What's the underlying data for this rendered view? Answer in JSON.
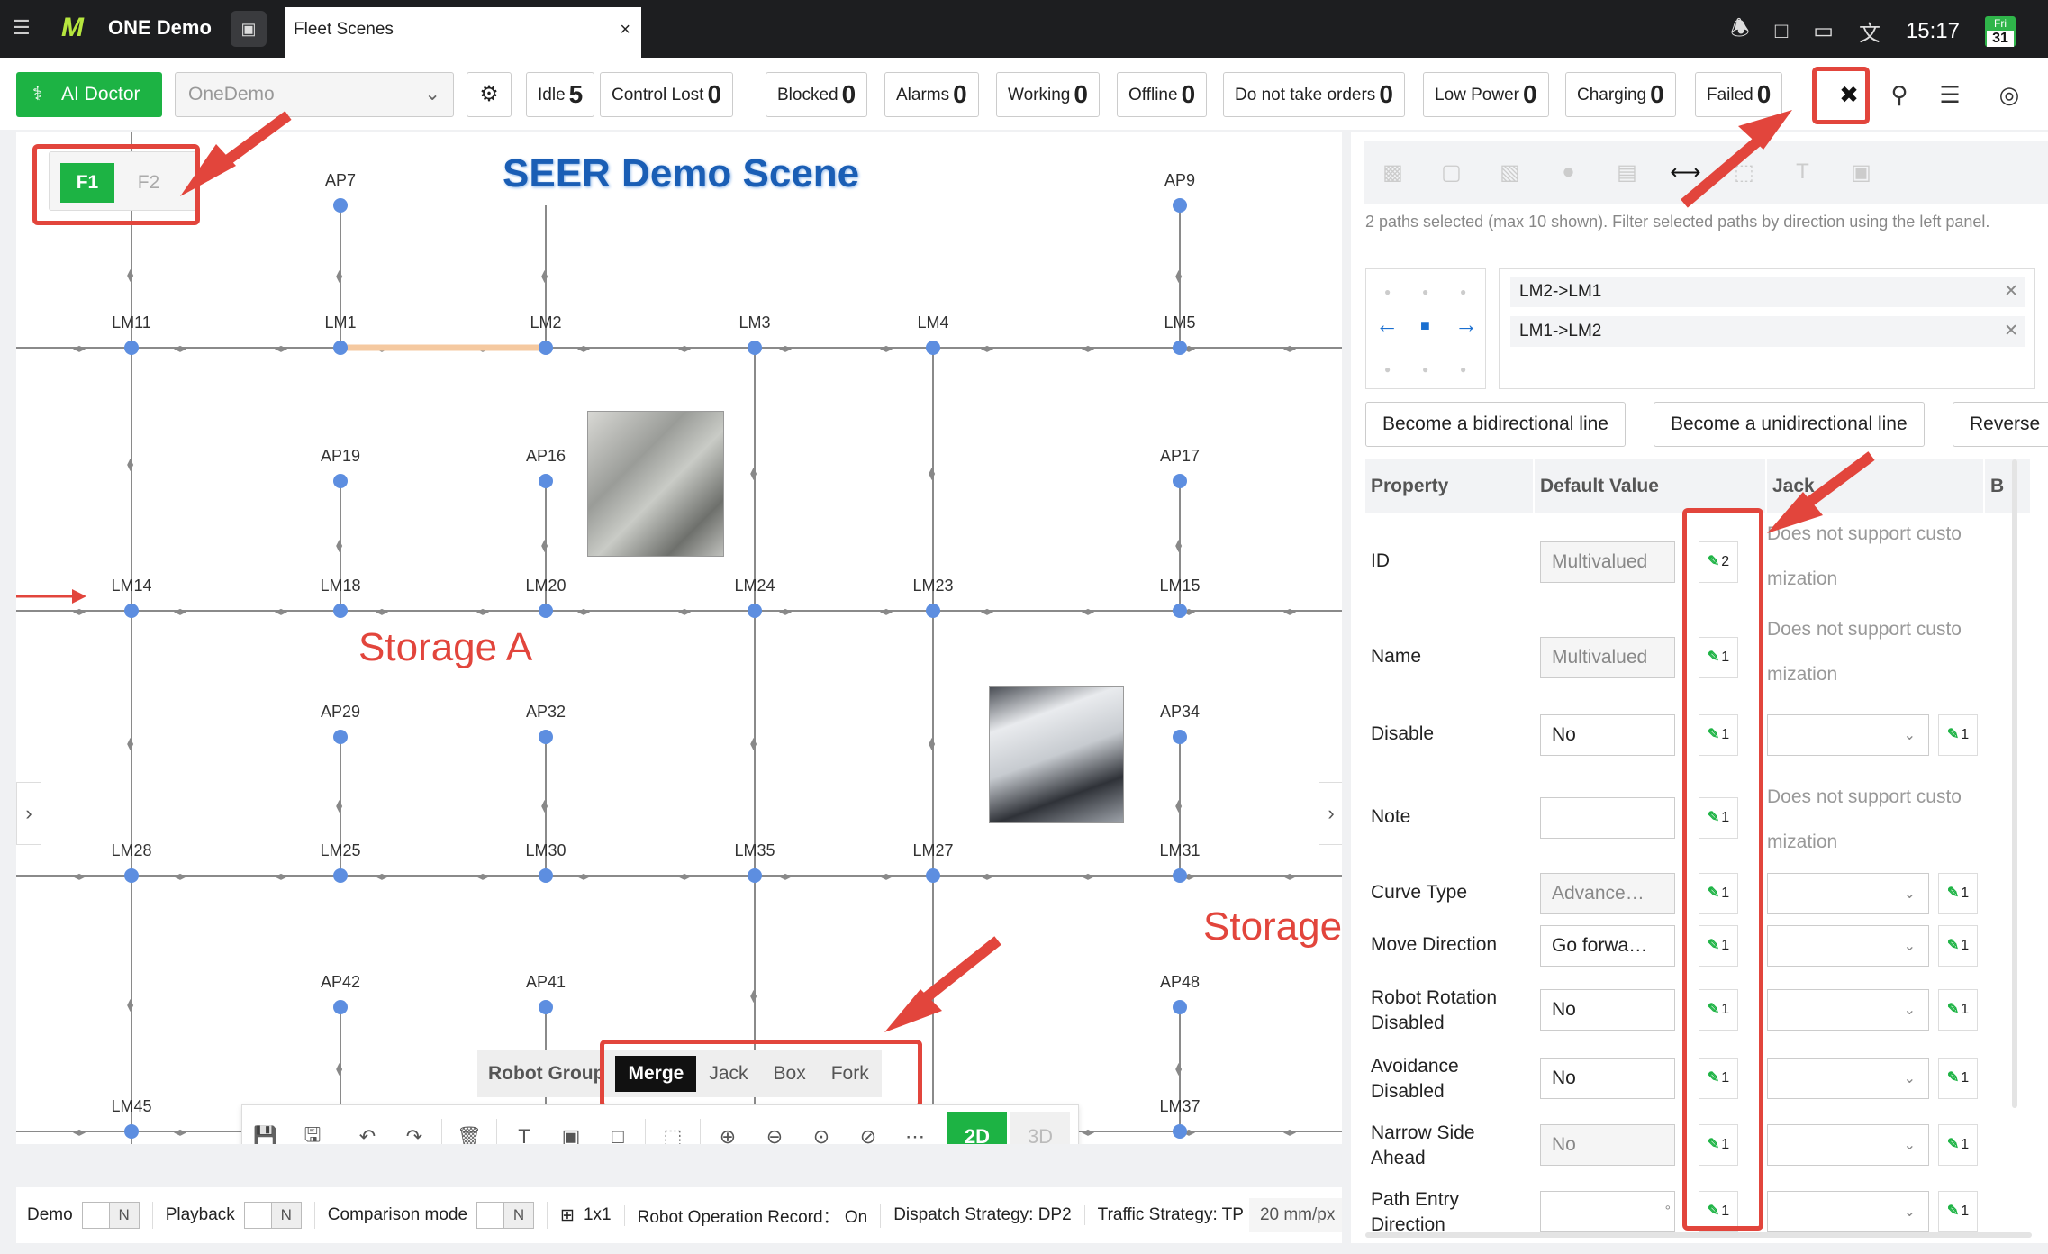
{
  "topbar": {
    "menu_icon": "menu-icon",
    "logo": "M",
    "app_name": "ONE Demo",
    "chip_icon": "ai-chip-icon",
    "tab_label": "Fleet Scenes",
    "tab_close": "×",
    "time": "15:17",
    "calendar_day": "Fri",
    "calendar_date": "31"
  },
  "toolbar": {
    "ai_doctor_label": "AI Doctor",
    "scene_value": "OneDemo",
    "stats": [
      {
        "label": "Idle",
        "count": "5"
      },
      {
        "label": "Control Lost",
        "count": "0"
      },
      {
        "label": "Blocked",
        "count": "0"
      },
      {
        "label": "Alarms",
        "count": "0"
      },
      {
        "label": "Working",
        "count": "0"
      },
      {
        "label": "Offline",
        "count": "0"
      },
      {
        "label": "Do not take orders",
        "count": "0"
      },
      {
        "label": "Low Power",
        "count": "0"
      },
      {
        "label": "Charging",
        "count": "0"
      },
      {
        "label": "Failed",
        "count": "0"
      }
    ]
  },
  "canvas": {
    "floor_1": "F1",
    "floor_2": "F2",
    "scene_title": "SEER Demo Scene",
    "storage_a": "Storage A",
    "storage_b": "Storage",
    "nodes": [
      "AP7",
      "AP9",
      "LM11",
      "LM1",
      "LM2",
      "LM3",
      "LM4",
      "LM5",
      "AP19",
      "AP16",
      "AP17",
      "LM14",
      "LM18",
      "LM20",
      "LM24",
      "LM23",
      "LM15",
      "AP29",
      "AP32",
      "AP34",
      "LM28",
      "LM25",
      "LM30",
      "LM35",
      "LM27",
      "LM31",
      "AP42",
      "AP41",
      "AP48",
      "LM45",
      "LM37"
    ],
    "robot_group_label": "Robot Group",
    "robot_groups": [
      "Merge",
      "Jack",
      "Box",
      "Fork"
    ],
    "view_2d": "2D",
    "view_3d": "3D"
  },
  "statusbar": {
    "demo": "Demo",
    "demo_toggle": "N",
    "playback": "Playback",
    "playback_toggle": "N",
    "comparison": "Comparison mode",
    "comparison_toggle": "N",
    "grid": "1x1",
    "record": "Robot Operation Record： On",
    "dispatch": "Dispatch Strategy: DP2",
    "traffic": "Traffic Strategy: TP",
    "scale": "20 mm/px"
  },
  "panel": {
    "selection_info": "2 paths selected (max 10 shown). Filter selected paths by direction using the left panel.",
    "paths": [
      "LM2->LM1",
      "LM1->LM2"
    ],
    "btn_bidirectional": "Become a bidirectional line",
    "btn_unidirectional": "Become a unidirectional line",
    "btn_reverse": "Reverse",
    "col_property": "Property",
    "col_default": "Default Value",
    "col_jack": "Jack",
    "col_b": "B",
    "not_supported_1": "Does not support custo",
    "not_supported_2": "mization",
    "rows": [
      {
        "label": "ID",
        "value": "Multivalued",
        "count": "2"
      },
      {
        "label": "Name",
        "value": "Multivalued",
        "count": "1"
      },
      {
        "label": "Disable",
        "value": "No",
        "count": "1",
        "jack_count": "1"
      },
      {
        "label": "Note",
        "value": "",
        "count": "1"
      },
      {
        "label": "Curve Type",
        "value": "Advance…",
        "count": "1",
        "jack_count": "1"
      },
      {
        "label": "Move Direction",
        "value": "Go forwa…",
        "count": "1",
        "jack_count": "1"
      },
      {
        "label": "Robot Rotation Disabled",
        "value": "No",
        "count": "1",
        "jack_count": "1"
      },
      {
        "label": "Avoidance Disabled",
        "value": "No",
        "count": "1",
        "jack_count": "1"
      },
      {
        "label": "Narrow Side Ahead",
        "value": "No",
        "count": "1",
        "jack_count": "1"
      },
      {
        "label": "Path Entry Direction",
        "value": "",
        "count": "1",
        "jack_count": "1"
      }
    ],
    "degree": "°"
  }
}
